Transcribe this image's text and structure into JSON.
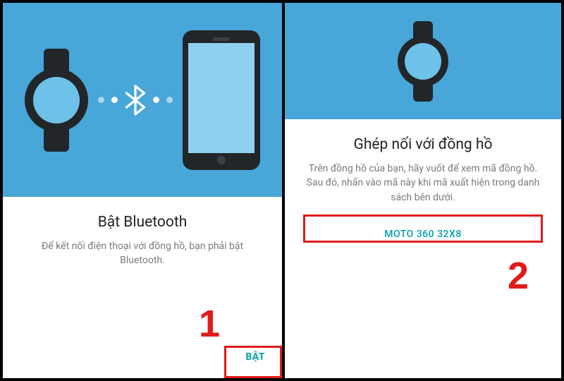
{
  "screen1": {
    "title": "Bật Bluetooth",
    "description": "Để kết nối điện thoại với đồng hồ, bạn phải bật Bluetooth.",
    "action_label": "BẬT",
    "step_number": "1"
  },
  "screen2": {
    "title": "Ghép nối với đồng hồ",
    "description": "Trên đồng hồ của bạn, hãy vuốt để xem mã đồng hồ. Sau đó, nhấn vào mã này khi mã xuất hiện trong danh sách bên dưới.",
    "device_name": "MOTO 360 32X8",
    "step_number": "2"
  },
  "colors": {
    "hero_bg": "#48a6d9",
    "accent": "#009faa",
    "annotation": "#e11b1b"
  }
}
